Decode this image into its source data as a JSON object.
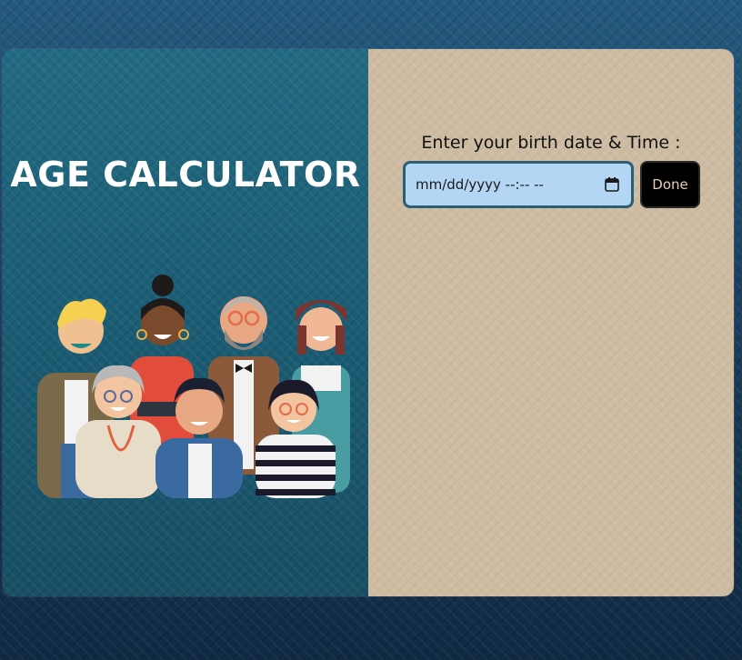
{
  "left_panel": {
    "title": "AGE CALCULATOR"
  },
  "right_panel": {
    "prompt": "Enter your birth date & Time :",
    "date_input": {
      "placeholder": "mm/dd/yyyy --:-- --",
      "icon": "calendar-icon"
    },
    "done_button": {
      "label": "Done"
    }
  },
  "colors": {
    "left_panel_bg": "#1d6177",
    "right_panel_bg": "#cdbba2",
    "input_bg": "#b3d6f4",
    "input_border": "#2c5f74",
    "button_bg": "#000000",
    "button_text": "#e3cfae"
  }
}
